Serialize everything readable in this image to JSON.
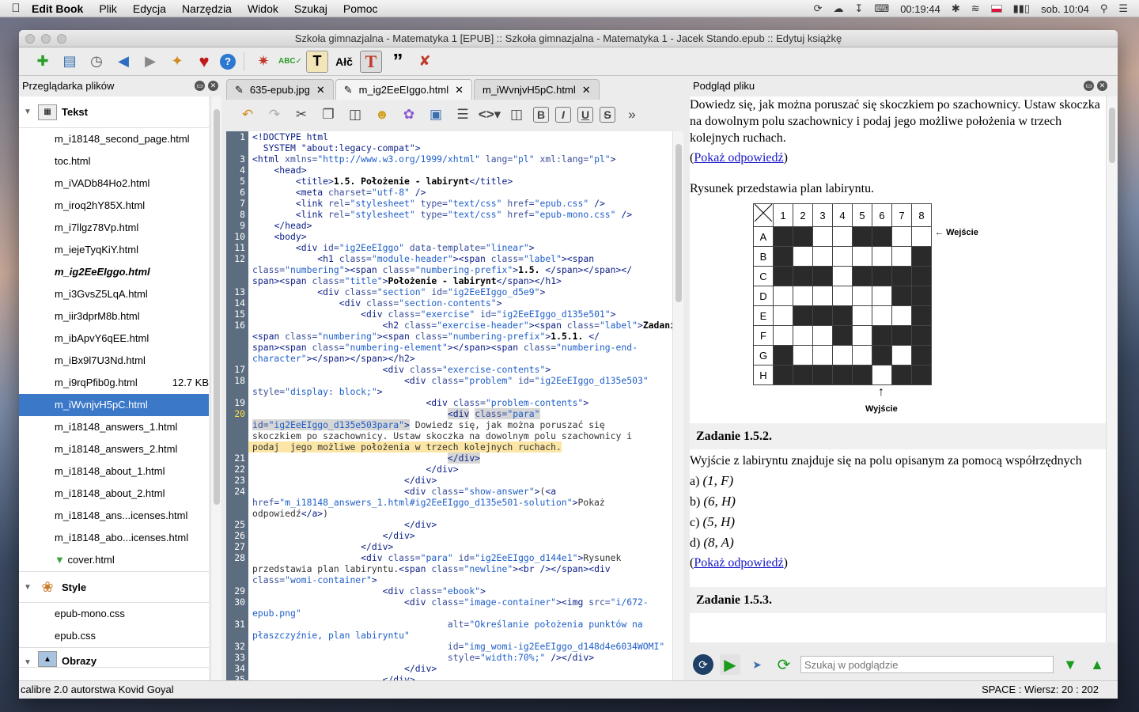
{
  "menubar": {
    "app": "Edit Book",
    "items": [
      "Plik",
      "Edycja",
      "Narzędzia",
      "Widok",
      "Szukaj",
      "Pomoc"
    ],
    "timer": "00:19:44",
    "clock": "sob. 10:04"
  },
  "window": {
    "title": "Szkoła gimnazjalna - Matematyka 1 [EPUB] :: Szkoła gimnazjalna - Matematyka 1 - Jacek Stando.epub :: Edytuj książkę"
  },
  "filebrowser": {
    "title": "Przeglądarka plików",
    "cat_text": "Tekst",
    "files": [
      {
        "name": "m_i18148_second_page.html"
      },
      {
        "name": "toc.html"
      },
      {
        "name": "m_iVADb84Ho2.html"
      },
      {
        "name": "m_iroq2hY85X.html"
      },
      {
        "name": "m_i7llgz78Vp.html"
      },
      {
        "name": "m_iejeTyqKiY.html"
      },
      {
        "name": "m_ig2EeEIggo.html"
      },
      {
        "name": "m_i3GvsZ5LqA.html"
      },
      {
        "name": "m_iir3dprM8b.html"
      },
      {
        "name": "m_ibApvY6qEE.html"
      },
      {
        "name": "m_iBx9l7U3Nd.html"
      },
      {
        "name": "m_i9rqPfib0g.html",
        "size": "12.7 KB"
      },
      {
        "name": "m_iWvnjvH5pC.html"
      },
      {
        "name": "m_i18148_answers_1.html"
      },
      {
        "name": "m_i18148_answers_2.html"
      },
      {
        "name": "m_i18148_about_1.html"
      },
      {
        "name": "m_i18148_about_2.html"
      },
      {
        "name": "m_i18148_ans...icenses.html"
      },
      {
        "name": "m_i18148_abo...icenses.html"
      },
      {
        "name": "cover.html"
      }
    ],
    "cat_style": "Style",
    "styles": [
      "epub-mono.css",
      "epub.css"
    ],
    "cat_images": "Obrazy"
  },
  "tabs": [
    {
      "label": "635-epub.jpg"
    },
    {
      "label": "m_ig2EeEIggo.html"
    },
    {
      "label": "m_iWvnjvH5pC.html"
    }
  ],
  "editor_tools": {
    "bold": "B",
    "italic": "I",
    "underline": "U",
    "strike": "S"
  },
  "code": [
    {
      "n": "1",
      "html": "<span class='t'>&lt;!DOCTYPE html</span>"
    },
    {
      "n": "",
      "html": "<span class='t'>  SYSTEM \"about:legacy-compat\"&gt;</span>"
    },
    {
      "n": "3",
      "html": "<span class='t'>&lt;html</span> <span class='a'>xmlns=</span><span class='v'>\"http://www.w3.org/1999/xhtml\"</span> <span class='a'>lang=</span><span class='v'>\"pl\"</span> <span class='a'>xml:lang=</span><span class='v'>\"pl\"</span><span class='t'>&gt;</span>"
    },
    {
      "n": "4",
      "html": "    <span class='t'>&lt;head&gt;</span>"
    },
    {
      "n": "5",
      "html": "        <span class='t'>&lt;title&gt;</span><span class='b'>1.5. Położenie - labirynt</span><span class='t'>&lt;/title&gt;</span>"
    },
    {
      "n": "6",
      "html": "        <span class='t'>&lt;meta</span> <span class='a'>charset=</span><span class='v'>\"utf-8\"</span> <span class='t'>/&gt;</span>"
    },
    {
      "n": "7",
      "html": "        <span class='t'>&lt;link</span> <span class='a'>rel=</span><span class='v'>\"stylesheet\"</span> <span class='a'>type=</span><span class='v'>\"text/css\"</span> <span class='a'>href=</span><span class='v'>\"epub.css\"</span> <span class='t'>/&gt;</span>"
    },
    {
      "n": "8",
      "html": "        <span class='t'>&lt;link</span> <span class='a'>rel=</span><span class='v'>\"stylesheet\"</span> <span class='a'>type=</span><span class='v'>\"text/css\"</span> <span class='a'>href=</span><span class='v'>\"epub-mono.css\"</span> <span class='t'>/&gt;</span>"
    },
    {
      "n": "9",
      "html": "    <span class='t'>&lt;/head&gt;</span>"
    },
    {
      "n": "10",
      "html": "    <span class='t'>&lt;body&gt;</span>"
    },
    {
      "n": "11",
      "html": "        <span class='t'>&lt;div</span> <span class='a'>id=</span><span class='v'>\"ig2EeEIggo\"</span> <span class='a'>data-template=</span><span class='v'>\"linear\"</span><span class='t'>&gt;</span>"
    },
    {
      "n": "12",
      "html": "            <span class='t'>&lt;h1</span> <span class='a'>class=</span><span class='v'>\"module-header\"</span><span class='t'>&gt;&lt;span</span> <span class='a'>class=</span><span class='v'>\"label\"</span><span class='t'>&gt;&lt;span</span>"
    },
    {
      "n": "",
      "html": "<span class='a'>class=</span><span class='v'>\"numbering\"</span><span class='t'>&gt;&lt;span</span> <span class='a'>class=</span><span class='v'>\"numbering-prefix\"</span><span class='t'>&gt;</span><span class='b'>1.5.</span> <span class='t'>&lt;/span&gt;&lt;/span&gt;&lt;/</span>"
    },
    {
      "n": "",
      "html": "<span class='t'>span&gt;&lt;span</span> <span class='a'>class=</span><span class='v'>\"title\"</span><span class='t'>&gt;</span><span class='b'>Położenie - labirynt</span><span class='t'>&lt;/span&gt;&lt;/h1&gt;</span>"
    },
    {
      "n": "13",
      "html": "            <span class='t'>&lt;div</span> <span class='a'>class=</span><span class='v'>\"section\"</span> <span class='a'>id=</span><span class='v'>\"ig2EeEIggo_d5e9\"</span><span class='t'>&gt;</span>"
    },
    {
      "n": "14",
      "html": "                <span class='t'>&lt;div</span> <span class='a'>class=</span><span class='v'>\"section-contents\"</span><span class='t'>&gt;</span>"
    },
    {
      "n": "15",
      "html": "                    <span class='t'>&lt;div</span> <span class='a'>class=</span><span class='v'>\"exercise\"</span> <span class='a'>id=</span><span class='v'>\"ig2EeEIggo_d135e501\"</span><span class='t'>&gt;</span>"
    },
    {
      "n": "16",
      "html": "                        <span class='t'>&lt;h2</span> <span class='a'>class=</span><span class='v'>\"exercise-header\"</span><span class='t'>&gt;&lt;span</span> <span class='a'>class=</span><span class='v'>\"label\"</span><span class='t'>&gt;</span><span class='b'>Zadanie</span>"
    },
    {
      "n": "",
      "html": "<span class='t'>&lt;span</span> <span class='a'>class=</span><span class='v'>\"numbering\"</span><span class='t'>&gt;&lt;span</span> <span class='a'>class=</span><span class='v'>\"numbering-prefix\"</span><span class='t'>&gt;</span><span class='b'>1.5.1.</span> <span class='t'>&lt;/</span>"
    },
    {
      "n": "",
      "html": "<span class='t'>span&gt;&lt;span</span> <span class='a'>class=</span><span class='v'>\"numbering-element\"</span><span class='t'>&gt;&lt;/span&gt;&lt;span</span> <span class='a'>class=</span><span class='v'>\"numbering-end-</span>"
    },
    {
      "n": "",
      "html": "<span class='v'>character\"</span><span class='t'>&gt;&lt;/span&gt;&lt;/span&gt;&lt;/h2&gt;</span>"
    },
    {
      "n": "17",
      "html": "                        <span class='t'>&lt;div</span> <span class='a'>class=</span><span class='v'>\"exercise-contents\"</span><span class='t'>&gt;</span>"
    },
    {
      "n": "18",
      "html": "                            <span class='t'>&lt;div</span> <span class='a'>class=</span><span class='v'>\"problem\"</span> <span class='a'>id=</span><span class='v'>\"ig2EeEIggo_d135e503\"</span>"
    },
    {
      "n": "",
      "html": "<span class='a'>style=</span><span class='v'>\"display: block;\"</span><span class='t'>&gt;</span>"
    },
    {
      "n": "19",
      "html": "                                <span class='t'>&lt;div</span> <span class='a'>class=</span><span class='v'>\"problem-contents\"</span><span class='t'>&gt;</span>"
    },
    {
      "n": "20",
      "cur": true,
      "html": "                                    <span class='t' style='background:#d6d6d6'>&lt;div</span> <span class='a' style='background:#d6d6d6'>class=</span><span class='v' style='background:#d6d6d6'>\"para\"</span>"
    },
    {
      "n": "",
      "html": "<span style='background:#d6d6d6'><span class='a'>id=</span><span class='v'>\"ig2EeEIggo_d135e503para\"</span><span class='t'>&gt;</span></span> Dowiedz się, jak można poruszać się"
    },
    {
      "n": "",
      "html": "skoczkiem po szachownicy. Ustaw skoczka na dowolnym polu szachownicy i"
    },
    {
      "n": "",
      "hl": true,
      "html": "podaj  jego możliwe położenia w trzech kolejnych ruchach."
    },
    {
      "n": "21",
      "html": "                                    <span class='t' style='background:#d6d6d6'>&lt;/div&gt;</span>"
    },
    {
      "n": "22",
      "html": "                                <span class='t'>&lt;/div&gt;</span>"
    },
    {
      "n": "23",
      "html": "                            <span class='t'>&lt;/div&gt;</span>"
    },
    {
      "n": "24",
      "html": "                            <span class='t'>&lt;div</span> <span class='a'>class=</span><span class='v'>\"show-answer\"</span><span class='t'>&gt;</span>(<span class='t'>&lt;a</span>"
    },
    {
      "n": "",
      "html": "<span class='a'>href=</span><span class='v'>\"m_i18148_answers_1.html#ig2EeEIggo_d135e501-solution\"</span><span class='t'>&gt;</span>Pokaż"
    },
    {
      "n": "",
      "html": "odpowiedź<span class='t'>&lt;/a&gt;</span>)"
    },
    {
      "n": "25",
      "html": "                            <span class='t'>&lt;/div&gt;</span>"
    },
    {
      "n": "26",
      "html": "                        <span class='t'>&lt;/div&gt;</span>"
    },
    {
      "n": "27",
      "html": "                    <span class='t'>&lt;/div&gt;</span>"
    },
    {
      "n": "28",
      "html": "                    <span class='t'>&lt;div</span> <span class='a'>class=</span><span class='v'>\"para\"</span> <span class='a'>id=</span><span class='v'>\"ig2EeEIggo_d144e1\"</span><span class='t'>&gt;</span>Rysunek"
    },
    {
      "n": "",
      "html": "przedstawia plan labiryntu.<span class='t'>&lt;span</span> <span class='a'>class=</span><span class='v'>\"newline\"</span><span class='t'>&gt;&lt;br /&gt;&lt;/span&gt;&lt;div</span>"
    },
    {
      "n": "",
      "html": "<span class='a'>class=</span><span class='v'>\"womi-container\"</span><span class='t'>&gt;</span>"
    },
    {
      "n": "29",
      "html": "                        <span class='t'>&lt;div</span> <span class='a'>class=</span><span class='v'>\"ebook\"</span><span class='t'>&gt;</span>"
    },
    {
      "n": "30",
      "html": "                            <span class='t'>&lt;div</span> <span class='a'>class=</span><span class='v'>\"image-container\"</span><span class='t'>&gt;&lt;img</span> <span class='a'>src=</span><span class='v'>\"i/672-</span>"
    },
    {
      "n": "",
      "html": "<span class='v'>epub.png\"</span>"
    },
    {
      "n": "31",
      "html": "                                    <span class='a'>alt=</span><span class='v'>\"Określanie położenia punktów na</span>"
    },
    {
      "n": "",
      "html": "<span class='v'>płaszczyźnie, plan labiryntu\"</span>"
    },
    {
      "n": "32",
      "html": "                                    <span class='a'>id=</span><span class='v'>\"img_womi-ig2EeEIggo_d148d4e6034WOMI\"</span>"
    },
    {
      "n": "33",
      "html": "                                    <span class='a'>style=</span><span class='v'>\"width:70%;\"</span> <span class='t'>/&gt;&lt;/div&gt;</span>"
    },
    {
      "n": "34",
      "html": "                            <span class='t'>&lt;/div&gt;</span>"
    },
    {
      "n": "35",
      "html": "                        <span class='t'>&lt;/div&gt;</span>"
    }
  ],
  "preview": {
    "title": "Podgląd pliku",
    "p1": "Dowiedz się, jak można poruszać się skoczkiem po szachownicy. Ustaw skoczka na dowolnym polu szachownicy i podaj jego możliwe położenia w trzech kolejnych ruchach.",
    "show_answer": "Pokaż odpowiedź",
    "p2": "Rysunek przedstawia plan labiryntu.",
    "maze": {
      "cols": [
        "1",
        "2",
        "3",
        "4",
        "5",
        "6",
        "7",
        "8"
      ],
      "rows": [
        {
          "label": "A",
          "cells": [
            1,
            1,
            0,
            0,
            1,
            1,
            0,
            0
          ]
        },
        {
          "label": "B",
          "cells": [
            1,
            0,
            0,
            0,
            0,
            0,
            0,
            1
          ]
        },
        {
          "label": "C",
          "cells": [
            1,
            1,
            1,
            0,
            1,
            1,
            1,
            1
          ]
        },
        {
          "label": "D",
          "cells": [
            0,
            0,
            0,
            0,
            0,
            0,
            1,
            1
          ]
        },
        {
          "label": "E",
          "cells": [
            0,
            1,
            1,
            1,
            0,
            0,
            0,
            1
          ]
        },
        {
          "label": "F",
          "cells": [
            0,
            0,
            0,
            1,
            0,
            1,
            1,
            1
          ]
        },
        {
          "label": "G",
          "cells": [
            1,
            0,
            0,
            0,
            0,
            1,
            0,
            1
          ]
        },
        {
          "label": "H",
          "cells": [
            1,
            1,
            1,
            1,
            1,
            0,
            1,
            1
          ]
        }
      ],
      "entry_label": "Wejście",
      "exit_label": "Wyjście"
    },
    "zad2": "Zadanie 1.5.2.",
    "zad2_text": "Wyjście z labiryntu znajduje się na polu opisanym za pomocą współrzędnych",
    "options": [
      {
        "letter": "a)",
        "value": "(1,  F)"
      },
      {
        "letter": "b)",
        "value": "(6,  H)"
      },
      {
        "letter": "c)",
        "value": "(5,  H)"
      },
      {
        "letter": "d)",
        "value": "(8,   A)"
      }
    ],
    "zad3": "Zadanie 1.5.3.",
    "search_placeholder": "Szukaj w podglądzie"
  },
  "status": {
    "left": "calibre 2.0 autorstwa Kovid Goyal",
    "right": "SPACE : Wiersz: 20 : 202"
  }
}
